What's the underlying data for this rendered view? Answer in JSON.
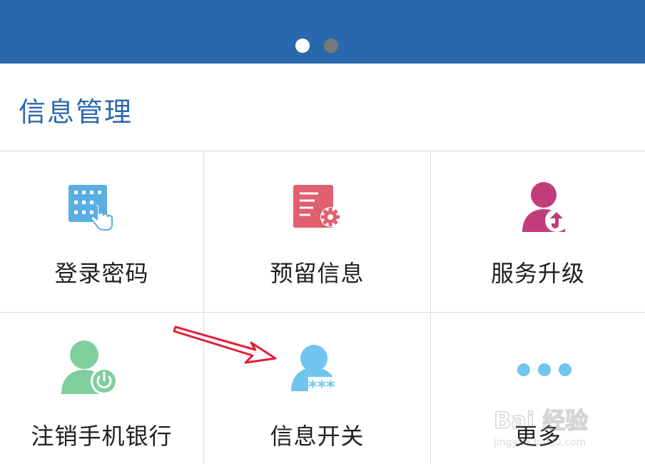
{
  "banner": {
    "color": "#2a68ad",
    "pager": {
      "count": 2,
      "active_index": 0
    }
  },
  "section": {
    "title": "信息管理",
    "title_color": "#2a68ad"
  },
  "grid": {
    "items": [
      {
        "label": "登录密码",
        "icon": "keypad-touch-icon",
        "icon_color": "#5aaee3"
      },
      {
        "label": "预留信息",
        "icon": "document-gear-icon",
        "icon_color": "#e06070"
      },
      {
        "label": "服务升级",
        "icon": "user-upgrade-icon",
        "icon_color": "#c23c7b"
      },
      {
        "label": "注销手机银行",
        "icon": "user-power-icon",
        "icon_color": "#7fcf9d"
      },
      {
        "label": "信息开关",
        "icon": "user-password-icon",
        "icon_color": "#6fc5ee"
      },
      {
        "label": "更多",
        "icon": "more-dots-icon",
        "icon_color": "#6fc5ee"
      }
    ]
  },
  "annotation": {
    "arrow_color": "#e0203a"
  },
  "watermark": {
    "text": "Bai 经验",
    "subtext": "jingyan.baidu.com"
  }
}
